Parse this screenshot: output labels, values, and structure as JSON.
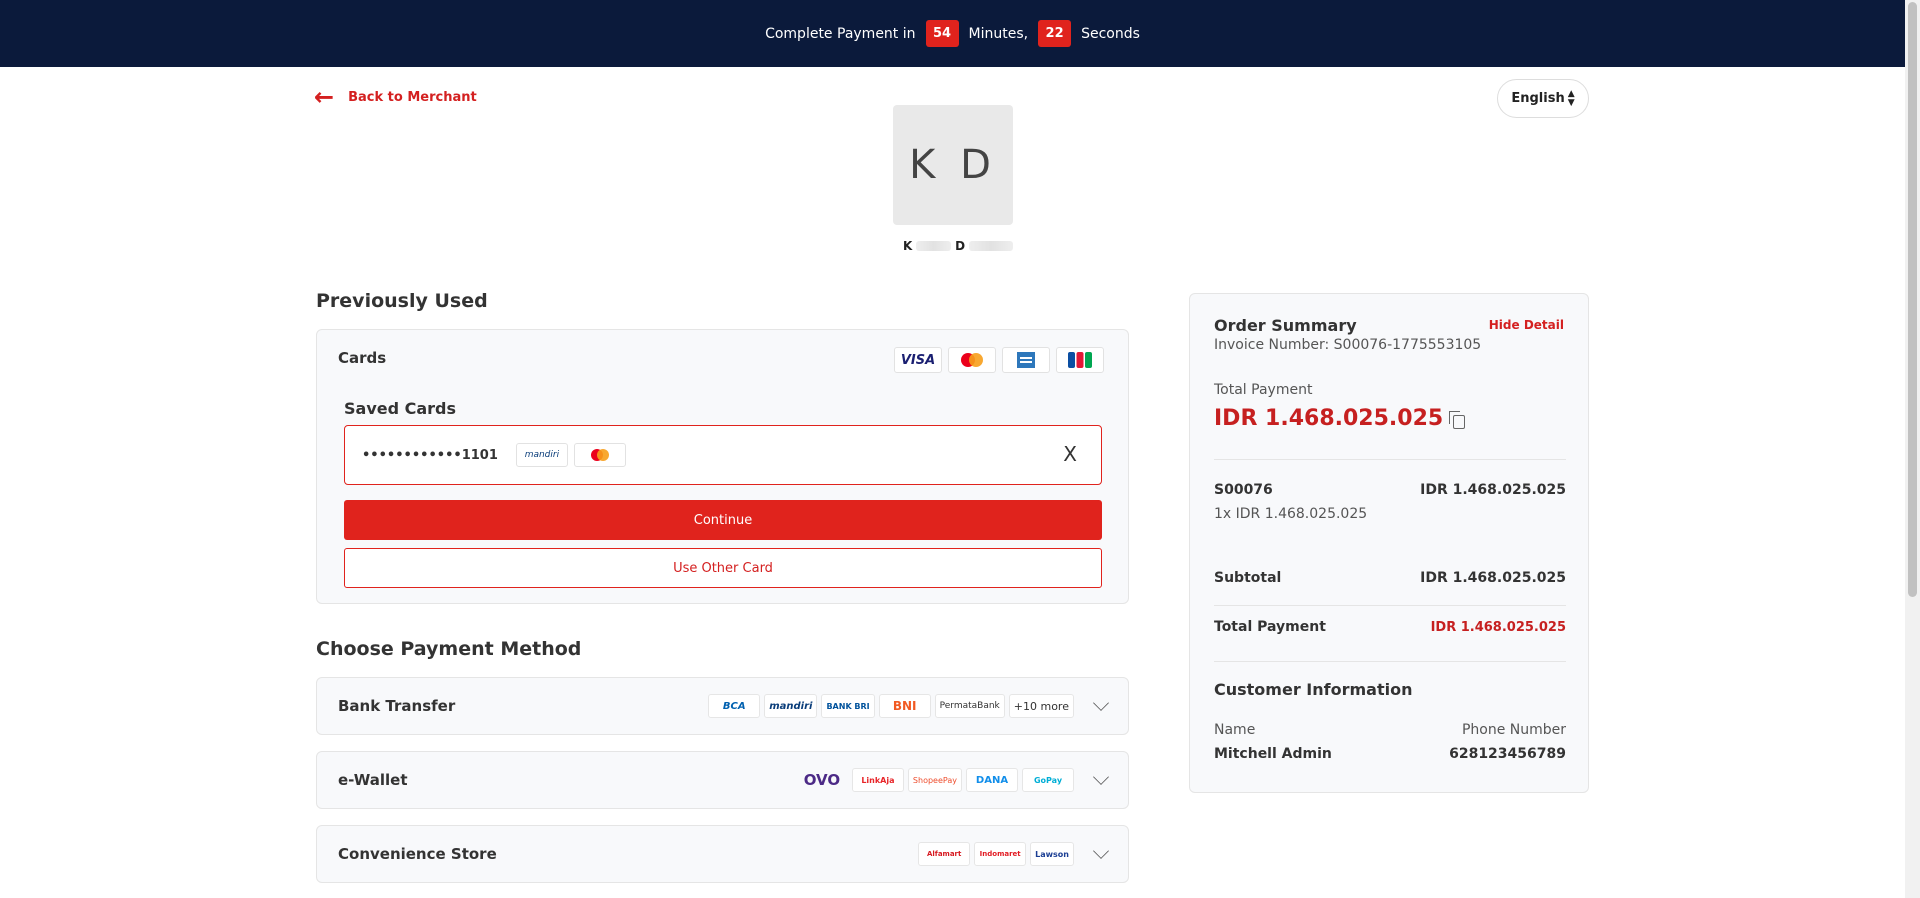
{
  "timer": {
    "prefix": "Complete Payment in",
    "minutes": "54",
    "minutes_label": "Minutes,",
    "seconds": "22",
    "seconds_label": "Seconds"
  },
  "header": {
    "back_label": "Back to Merchant",
    "language": "English"
  },
  "merchant": {
    "logo_text": "K D",
    "name_first": "K",
    "name_second": "D"
  },
  "previously_used": {
    "title": "Previously Used",
    "cards_label": "Cards",
    "brands": [
      "VISA",
      "mastercard",
      "amex",
      "JCB"
    ],
    "saved_cards_title": "Saved Cards",
    "saved_card_number": "••••••••••••1101",
    "saved_card_bank": "mandiri",
    "saved_card_network": "mastercard",
    "close_glyph": "X",
    "continue_label": "Continue",
    "other_card_label": "Use Other Card"
  },
  "payment_methods": {
    "title": "Choose Payment Method",
    "items": [
      {
        "label": "Bank Transfer",
        "logos": [
          "BCA",
          "mandiri",
          "BANK BRI",
          "BNI",
          "PermataBank"
        ],
        "more": "+10 more"
      },
      {
        "label": "e-Wallet",
        "logos": [
          "OVO",
          "LinkAja",
          "ShopeePay",
          "DANA",
          "GoPay"
        ],
        "more": ""
      },
      {
        "label": "Convenience Store",
        "logos": [
          "Alfamart",
          "Indomaret",
          "Lawson"
        ],
        "more": ""
      }
    ]
  },
  "summary": {
    "title": "Order Summary",
    "hide_label": "Hide Detail",
    "invoice": "Invoice Number: S00076-1775553105",
    "total_payment_label": "Total Payment",
    "total_payment_value": "IDR 1.468.025.025",
    "item_name": "S00076",
    "item_price": "IDR 1.468.025.025",
    "item_qty": "1x IDR 1.468.025.025",
    "subtotal_label": "Subtotal",
    "subtotal_value": "IDR 1.468.025.025",
    "total_label": "Total Payment",
    "total_value": "IDR 1.468.025.025",
    "customer_title": "Customer Information",
    "name_label": "Name",
    "name_value": "Mitchell Admin",
    "phone_label": "Phone Number",
    "phone_value": "628123456789"
  },
  "colors": {
    "topbar": "#0b1a3b",
    "accent": "#e0231d",
    "price": "#c62020"
  },
  "icons": {
    "back": "arrow-left-icon",
    "copy": "copy-icon",
    "chevron": "chevron-down-icon"
  }
}
